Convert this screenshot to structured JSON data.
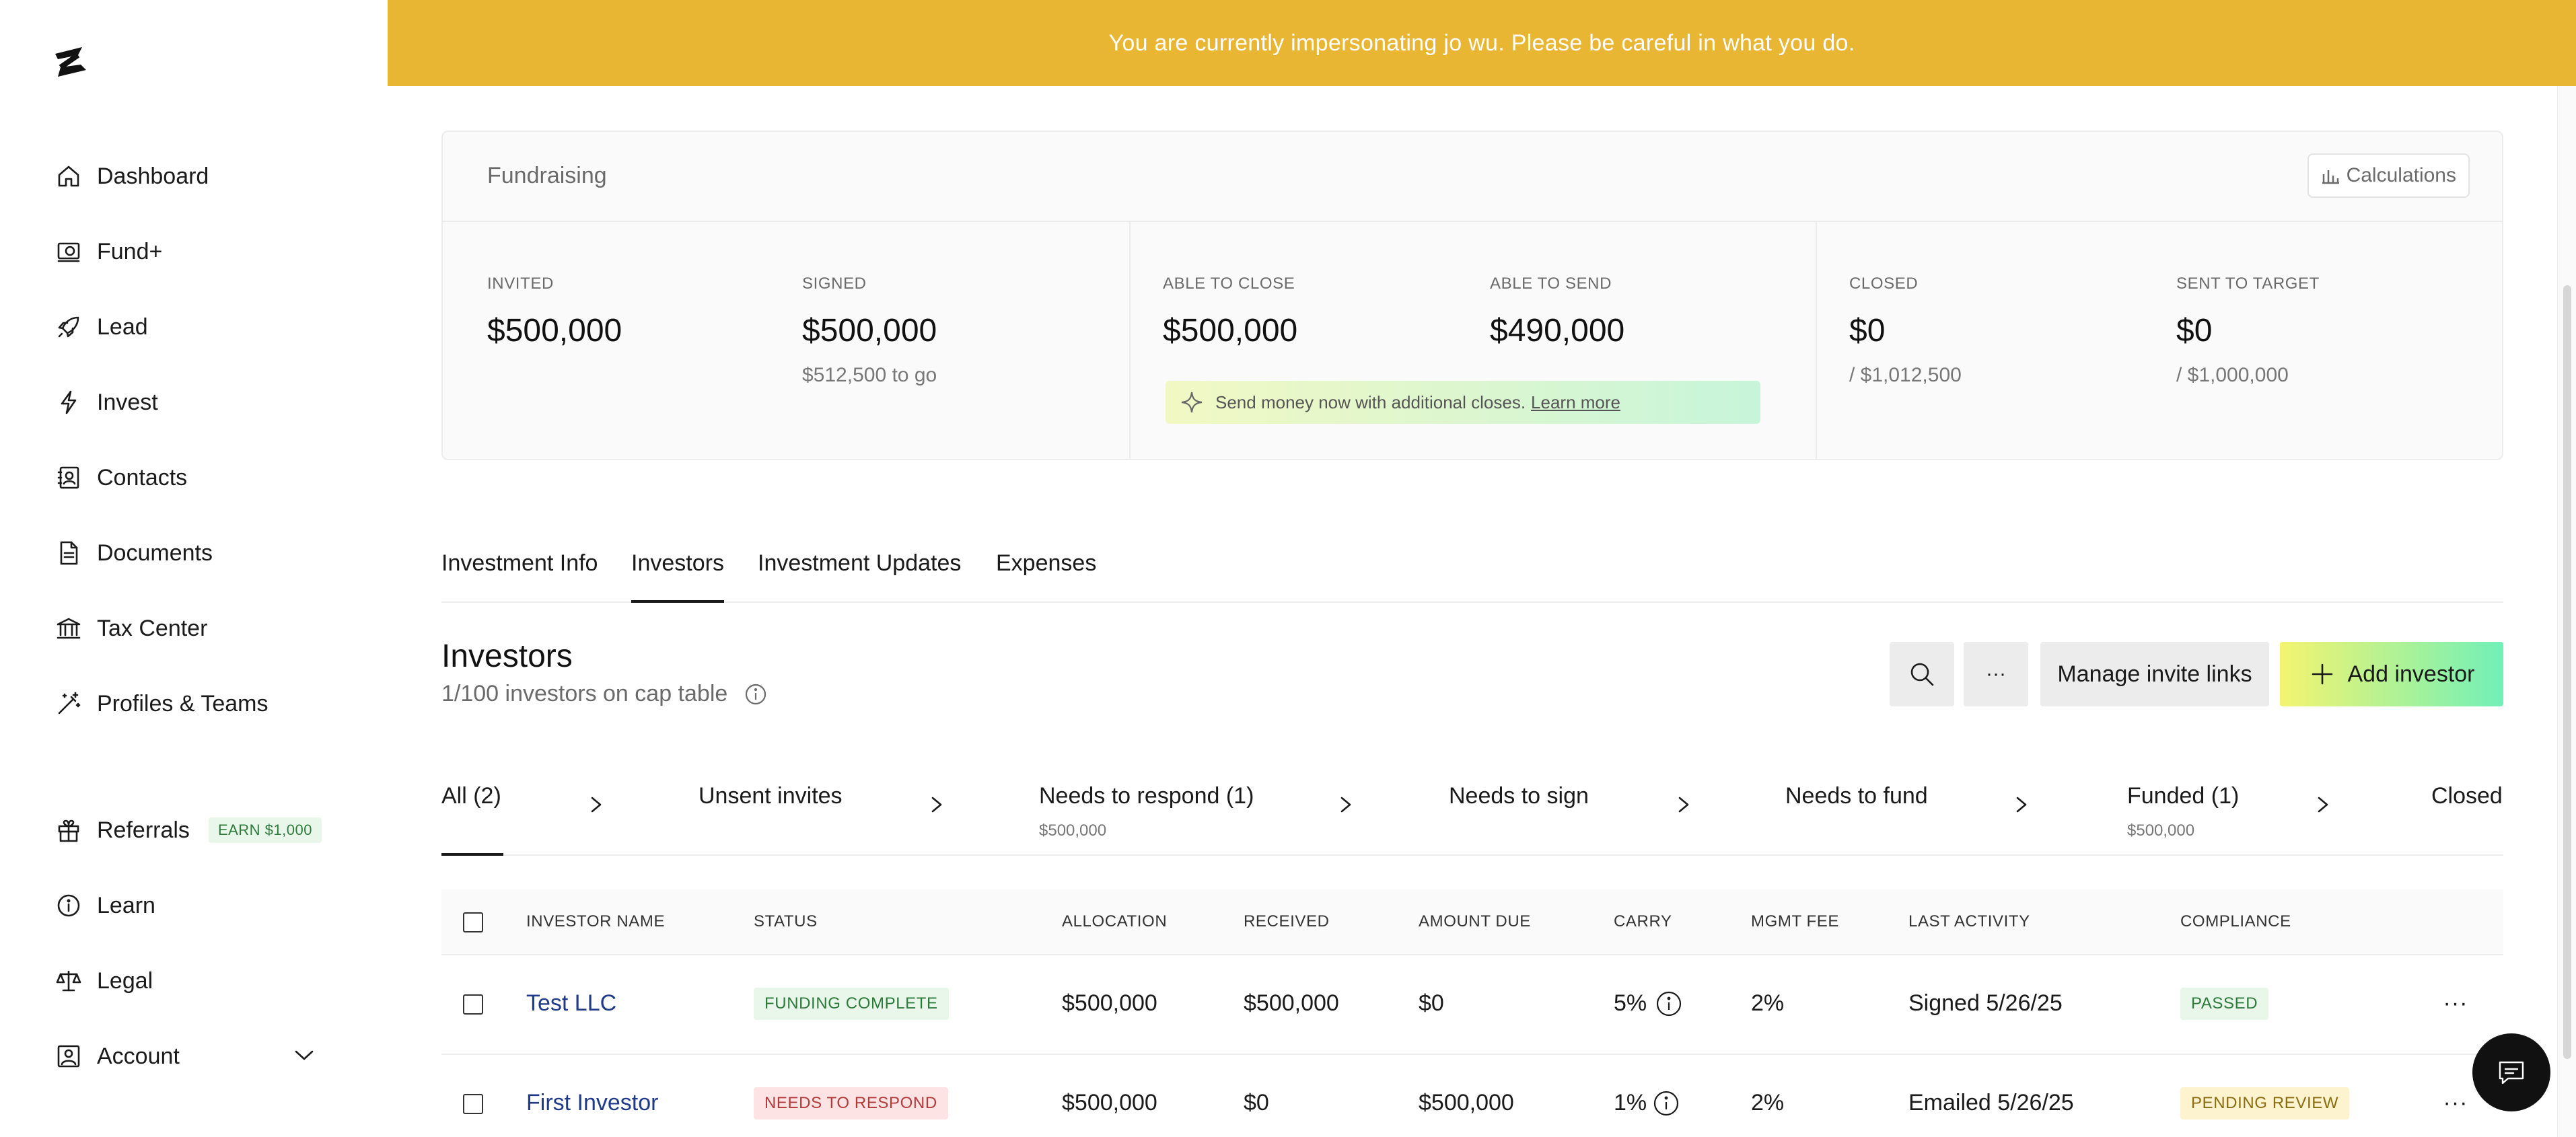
{
  "banner": {
    "text": "You are currently impersonating jo wu. Please be careful in what you do."
  },
  "sidebar": {
    "items": [
      {
        "label": "Dashboard",
        "icon": "home-icon"
      },
      {
        "label": "Fund+",
        "icon": "fund-plus-icon"
      },
      {
        "label": "Lead",
        "icon": "rocket-icon"
      },
      {
        "label": "Invest",
        "icon": "lightning-icon"
      },
      {
        "label": "Contacts",
        "icon": "contact-card-icon"
      },
      {
        "label": "Documents",
        "icon": "document-icon"
      },
      {
        "label": "Tax Center",
        "icon": "bank-icon"
      },
      {
        "label": "Profiles & Teams",
        "icon": "magic-wand-icon"
      }
    ],
    "secondary": [
      {
        "label": "Referrals",
        "icon": "gift-icon",
        "badge": "EARN $1,000"
      },
      {
        "label": "Learn",
        "icon": "info-circle-icon"
      },
      {
        "label": "Legal",
        "icon": "scale-icon"
      },
      {
        "label": "Account",
        "icon": "account-icon"
      }
    ]
  },
  "fundraising": {
    "title": "Fundraising",
    "calc_label": "Calculations",
    "invited": {
      "label": "INVITED",
      "value": "$500,000"
    },
    "signed": {
      "label": "SIGNED",
      "value": "$500,000",
      "sub": "$512,500 to go"
    },
    "able_to_close": {
      "label": "ABLE TO CLOSE",
      "value": "$500,000"
    },
    "able_to_send": {
      "label": "ABLE TO SEND",
      "value": "$490,000"
    },
    "closed": {
      "label": "CLOSED",
      "value": "$0",
      "sub": "/ $1,012,500"
    },
    "sent_to_target": {
      "label": "SENT TO TARGET",
      "value": "$0",
      "sub": "/ $1,000,000"
    },
    "send_note": "Send money now with additional closes.",
    "learn_more": "Learn more"
  },
  "tabs": [
    "Investment Info",
    "Investors",
    "Investment Updates",
    "Expenses"
  ],
  "active_tab": "Investors",
  "investors": {
    "title": "Investors",
    "subtitle": "1/100 investors on cap table",
    "manage_invite_links": "Manage invite links",
    "add_investor": "Add investor",
    "more_label": "···"
  },
  "filters": [
    {
      "label": "All (2)",
      "sub": ""
    },
    {
      "label": "Unsent invites",
      "sub": ""
    },
    {
      "label": "Needs to respond (1)",
      "sub": "$500,000"
    },
    {
      "label": "Needs to sign",
      "sub": ""
    },
    {
      "label": "Needs to fund",
      "sub": ""
    },
    {
      "label": "Funded (1)",
      "sub": "$500,000"
    },
    {
      "label": "Closed",
      "sub": ""
    }
  ],
  "table": {
    "columns": [
      "INVESTOR NAME",
      "STATUS",
      "ALLOCATION",
      "RECEIVED",
      "AMOUNT DUE",
      "CARRY",
      "MGMT FEE",
      "LAST ACTIVITY",
      "COMPLIANCE"
    ],
    "rows": [
      {
        "name": "Test LLC",
        "status": "FUNDING COMPLETE",
        "allocation": "$500,000",
        "received": "$500,000",
        "amount_due": "$0",
        "carry": "5%",
        "mgmt_fee": "2%",
        "last_activity": "Signed 5/26/25",
        "compliance": "PASSED"
      },
      {
        "name": "First Investor",
        "status": "NEEDS TO RESPOND",
        "allocation": "$500,000",
        "received": "$0",
        "amount_due": "$500,000",
        "carry": "1%",
        "mgmt_fee": "2%",
        "last_activity": "Emailed 5/26/25",
        "compliance": "PENDING REVIEW"
      }
    ],
    "row_menu": "···"
  },
  "colors": {
    "banner": "#e9b634",
    "status_complete_bg": "#e8f7e9",
    "status_complete_fg": "#2d7a3a",
    "status_respond_bg": "#fde3e3",
    "status_respond_fg": "#b33a3a",
    "compliance_pending_bg": "#fdf3cf",
    "compliance_pending_fg": "#8a6d10"
  }
}
